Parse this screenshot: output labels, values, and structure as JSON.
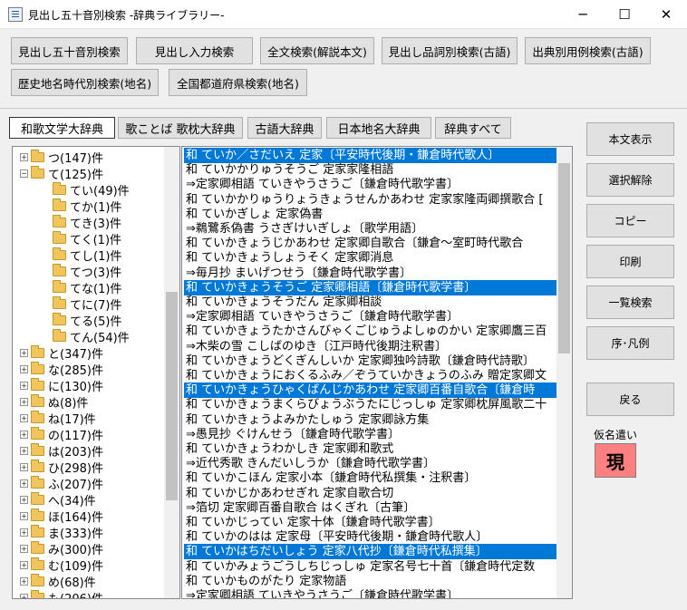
{
  "window": {
    "title": "見出し五十音別検索 -辞典ライブラリー-",
    "min": "─",
    "max": "☐",
    "close": "✕"
  },
  "top_buttons": [
    "見出し五十音別検索",
    "見出し入力検索",
    "全文検索(解説本文)",
    "見出し品詞別検索(古語)",
    "出典別用例検索(古語)",
    "歴史地名時代別検索(地名)",
    "全国都道府県検索(地名)"
  ],
  "tabs": [
    "和歌文学大辞典",
    "歌ことば 歌枕大辞典",
    "古語大辞典",
    "日本地名大辞典",
    "辞典すべて"
  ],
  "tree": [
    {
      "label": "つ(147)件",
      "level": 0
    },
    {
      "label": "て(125)件",
      "level": 0,
      "expanded": true
    },
    {
      "label": "てい(49)件",
      "level": 1
    },
    {
      "label": "てか(1)件",
      "level": 1
    },
    {
      "label": "てき(3)件",
      "level": 1
    },
    {
      "label": "てく(1)件",
      "level": 1
    },
    {
      "label": "てし(1)件",
      "level": 1
    },
    {
      "label": "てつ(3)件",
      "level": 1
    },
    {
      "label": "てな(1)件",
      "level": 1
    },
    {
      "label": "てに(7)件",
      "level": 1
    },
    {
      "label": "てる(5)件",
      "level": 1
    },
    {
      "label": "てん(54)件",
      "level": 1
    },
    {
      "label": "と(347)件",
      "level": 0
    },
    {
      "label": "な(285)件",
      "level": 0
    },
    {
      "label": "に(130)件",
      "level": 0
    },
    {
      "label": "ぬ(8)件",
      "level": 0
    },
    {
      "label": "ね(17)件",
      "level": 0
    },
    {
      "label": "の(117)件",
      "level": 0
    },
    {
      "label": "は(203)件",
      "level": 0
    },
    {
      "label": "ひ(298)件",
      "level": 0
    },
    {
      "label": "ふ(207)件",
      "level": 0
    },
    {
      "label": "へ(34)件",
      "level": 0
    },
    {
      "label": "ほ(164)件",
      "level": 0
    },
    {
      "label": "ま(333)件",
      "level": 0
    },
    {
      "label": "み(300)件",
      "level": 0
    },
    {
      "label": "む(109)件",
      "level": 0
    },
    {
      "label": "め(68)件",
      "level": 0
    },
    {
      "label": "も(206)件",
      "level": 0
    }
  ],
  "results": [
    {
      "text": "和 ていか／さだいえ 定家〔平安時代後期・鎌倉時代歌人〕",
      "selected": true
    },
    {
      "text": "和 ていかかりゅうそうご 定家家隆相語",
      "selected": false
    },
    {
      "text": " ⇒定家卿相語 ていきやうさうご〔鎌倉時代歌学書〕",
      "selected": false
    },
    {
      "text": "和 ていかかりゅうりょうきょうせんかあわせ 定家家隆両卿撰歌合 [",
      "selected": false
    },
    {
      "text": "和 ていかぎしょ 定家偽書",
      "selected": false
    },
    {
      "text": " ⇒鵜鷺系偽書 うさぎけいぎしょ〔歌学用語〕",
      "selected": false
    },
    {
      "text": "和 ていかきょうじかあわせ 定家卿自歌合〔鎌倉～室町時代歌合",
      "selected": false
    },
    {
      "text": "和 ていかきょうしょうそく 定家卿消息",
      "selected": false
    },
    {
      "text": " ⇒毎月抄 まいげつせう〔鎌倉時代歌学書〕",
      "selected": false
    },
    {
      "text": "和 ていかきょうそうご 定家卿相語〔鎌倉時代歌学書〕",
      "selected": true
    },
    {
      "text": "和 ていかきょうそうだん 定家卿相談",
      "selected": false
    },
    {
      "text": " ⇒定家卿相語 ていきやうさうご〔鎌倉時代歌学書〕",
      "selected": false
    },
    {
      "text": "和 ていかきょうたかさんびゃくごじゅうよしゅのかい 定家卿鷹三百",
      "selected": false
    },
    {
      "text": " ⇒木柴の雪 こしばのゆき〔江戸時代後期注釈書〕",
      "selected": false
    },
    {
      "text": "和 ていかきょうどくぎんしいか 定家卿独吟詩歌〔鎌倉時代詩歌〕",
      "selected": false
    },
    {
      "text": "和 ていかきょうにおくるふみ／ぞうていかきょうのふみ 贈定家卿文",
      "selected": false
    },
    {
      "text": "和 ていかきょうひゃくばんじかあわせ 定家卿百番自歌合〔鎌倉時",
      "selected": true
    },
    {
      "text": "和 ていかきょうまくらびょうぶうたにじっしゅ 定家卿枕屏風歌二十",
      "selected": false
    },
    {
      "text": "和 ていかきょうよみかたしゅう 定家卿詠方集",
      "selected": false
    },
    {
      "text": " ⇒愚見抄 ぐけんせう〔鎌倉時代歌学書〕",
      "selected": false
    },
    {
      "text": "和 ていかきょうわかしき 定家卿和歌式",
      "selected": false
    },
    {
      "text": " ⇒近代秀歌 きんだいしうか〔鎌倉時代歌学書〕",
      "selected": false
    },
    {
      "text": "和 ていかこほん 定家小本〔鎌倉時代私撰集・注釈書〕",
      "selected": false
    },
    {
      "text": "和 ていかじかあわせぎれ 定家自歌合切",
      "selected": false
    },
    {
      "text": " ⇒箔切 定家卿百番自歌合 はくぎれ〔古筆〕",
      "selected": false
    },
    {
      "text": "和 ていかじってい 定家十体〔鎌倉時代歌学書〕",
      "selected": false
    },
    {
      "text": "和 ていかのはは 定家母〔平安時代後期・鎌倉時代歌人〕",
      "selected": false
    },
    {
      "text": "和 ていかはちだいしょう 定家八代抄〔鎌倉時代私撰集〕",
      "selected": true
    },
    {
      "text": "和 ていかみょうごうしちじっしゅ 定家名号七十首〔鎌倉時代定数",
      "selected": false
    },
    {
      "text": "和 ていかものがたり 定家物語",
      "selected": false
    },
    {
      "text": " ⇒定家卿相語 ていきやうさうご〔鎌倉時代歌学書〕",
      "selected": false
    },
    {
      "text": "和 ていかもんじょ 定家文書〔鎌倉時代歌学書〕",
      "selected": false
    }
  ],
  "side_buttons": [
    "本文表示",
    "選択解除",
    "コピー",
    "印刷",
    "一覧検索",
    "序･凡例",
    "戻る"
  ],
  "kana": {
    "label": "仮名遣い",
    "value": "現"
  }
}
